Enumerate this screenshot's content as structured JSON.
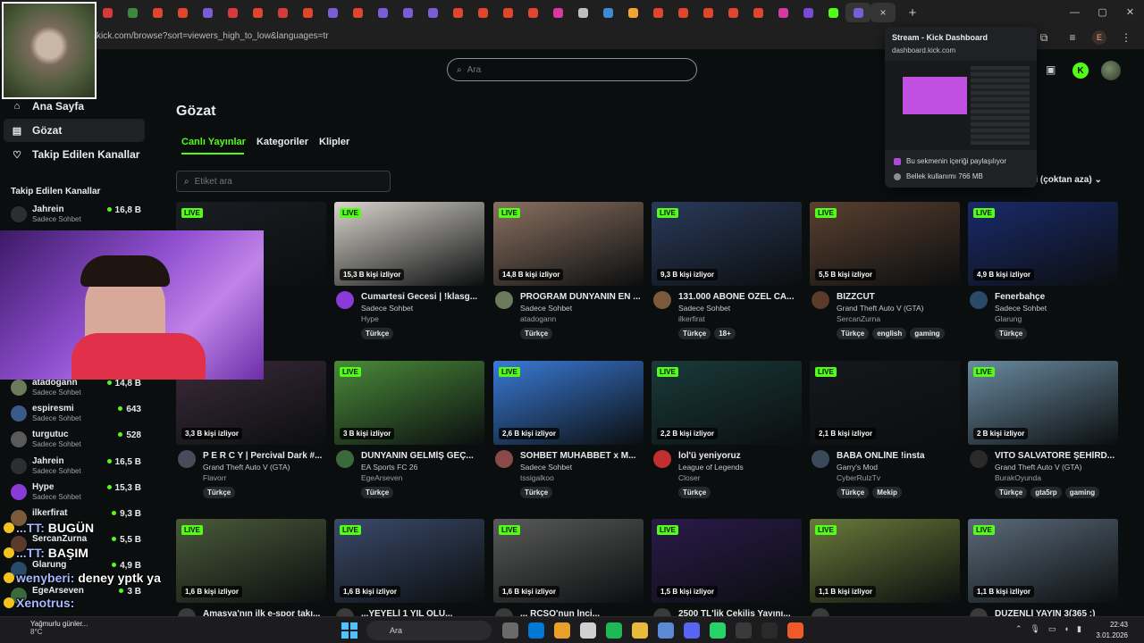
{
  "browser": {
    "url": "kick.com/browse?sort=viewers_high_to_low&languages=tr",
    "tab_colors": [
      "#d63a3a",
      "#3b8a3b",
      "#e0452e",
      "#e0452e",
      "#7a5cd6",
      "#d63a3a",
      "#e0452e",
      "#d63a3a",
      "#e0452e",
      "#7a5cd6",
      "#e0452e",
      "#7a5cd6",
      "#7a5cd6",
      "#7a5cd6",
      "#e0452e",
      "#e0452e",
      "#e0452e",
      "#e0452e",
      "#d63aa0",
      "#bfbfbf",
      "#3b8ad6",
      "#f2a531",
      "#e0452e",
      "#e0452e",
      "#e0452e",
      "#e0452e",
      "#e0452e",
      "#d63aa0",
      "#7a4ad6",
      "#53fc18",
      "#7a5cd6"
    ],
    "tab_close": "×",
    "new_tab": "+",
    "profile_letter": "E"
  },
  "tab_popup": {
    "title": "Stream - Kick Dashboard",
    "url": "dashboard.kick.com",
    "sharing_text": "Bu sekmenin içeriği paylaşılıyor",
    "memory_text": "Bellek kullanımı 766 MB"
  },
  "header": {
    "search_placeholder": "Ara",
    "logo_letter": "K"
  },
  "sidebar": {
    "nav": [
      {
        "label": "Ana Sayfa",
        "icon": "home-icon",
        "glyph": "⌂"
      },
      {
        "label": "Gözat",
        "icon": "browse-icon",
        "glyph": "▤"
      },
      {
        "label": "Takip Edilen Kanallar",
        "icon": "heart-icon",
        "glyph": "♡"
      }
    ],
    "following_title": "Takip Edilen Kanallar",
    "channels": [
      {
        "name": "Jahrein",
        "category": "Sadece Sohbet",
        "viewers": "16,8 B",
        "color": "#2c2f31"
      },
      {
        "name": "atadogann",
        "category": "Sadece Sohbet",
        "viewers": "14,8 B",
        "color": "#6b7a5a"
      },
      {
        "name": "espiresmi",
        "category": "Sadece Sohbet",
        "viewers": "643",
        "color": "#3a5a8a"
      },
      {
        "name": "turgutuc",
        "category": "Sadece Sohbet",
        "viewers": "528",
        "color": "#5a5a5a"
      },
      {
        "name": "Jahrein",
        "category": "Sadece Sohbet",
        "viewers": "16,5 B",
        "color": "#2c2f31"
      },
      {
        "name": "Hype",
        "category": "Sadece Sohbet",
        "viewers": "15,3 B",
        "color": "#8a3ad6"
      },
      {
        "name": "ilkerfirat",
        "category": "",
        "viewers": "9,3 B",
        "color": "#7a5a3a"
      },
      {
        "name": "SercanZurna",
        "category": "",
        "viewers": "5,5 B",
        "color": "#5a3a2a"
      },
      {
        "name": "Glarung",
        "category": "",
        "viewers": "4,9 B",
        "color": "#2a4a6a"
      },
      {
        "name": "EgeArseven",
        "category": "",
        "viewers": "3 B",
        "color": "#3a6a3a"
      }
    ]
  },
  "main": {
    "title": "Gözat",
    "tabs": [
      "Canlı Yayınlar",
      "Kategoriler",
      "Klipler"
    ],
    "tag_search_placeholder": "Etiket ara",
    "sort_label": "ici (çoktan aza)",
    "live_label": "LIVE",
    "cards": [
      {
        "viewers": "",
        "title": "adara olma...",
        "category": "",
        "channel": "",
        "tags": [],
        "thumb": "#1a1d22",
        "avatar": "#2c2f31"
      },
      {
        "viewers": "15,3 B kişi izliyor",
        "title": "Cumartesi Gecesi | !klasg...",
        "category": "Sadece Sohbet",
        "channel": "Hype",
        "tags": [
          "Türkçe"
        ],
        "thumb": "#d9d4cc",
        "avatar": "#8a3ad6"
      },
      {
        "viewers": "14,8 B kişi izliyor",
        "title": "PROGRAM DÜNYANIN EN ...",
        "category": "Sadece Sohbet",
        "channel": "atadogann",
        "tags": [
          "Türkçe"
        ],
        "thumb": "#8a7060",
        "avatar": "#6b7a5a"
      },
      {
        "viewers": "9,3 B kişi izliyor",
        "title": "131.000 ABONE ÖZEL CA...",
        "category": "Sadece Sohbet",
        "channel": "ilkerfirat",
        "tags": [
          "Türkçe",
          "18+"
        ],
        "thumb": "#2a3a5a",
        "avatar": "#7a5a3a"
      },
      {
        "viewers": "5,5 B kişi izliyor",
        "title": "BIZZCUT",
        "category": "Grand Theft Auto V (GTA)",
        "channel": "SercanZurna",
        "tags": [
          "Türkçe",
          "english",
          "gaming"
        ],
        "thumb": "#5a4030",
        "avatar": "#5a3a2a"
      },
      {
        "viewers": "4,9 B kişi izliyor",
        "title": "Fenerbahçe",
        "category": "Sadece Sohbet",
        "channel": "Glarung",
        "tags": [
          "Türkçe"
        ],
        "thumb": "#1a2a6a",
        "avatar": "#2a4a6a"
      },
      {
        "viewers": "3,3 B kişi izliyor",
        "title": "P E R C Y | Percival Dark #...",
        "category": "Grand Theft Auto V (GTA)",
        "channel": "Flavorr",
        "tags": [
          "Türkçe"
        ],
        "thumb": "#3a2a3a",
        "avatar": "#4a4a5a"
      },
      {
        "viewers": "3 B kişi izliyor",
        "title": "DÜNYANIN GELMİŞ GEÇ...",
        "category": "EA Sports FC 26",
        "channel": "EgeArseven",
        "tags": [
          "Türkçe"
        ],
        "thumb": "#4a8a3a",
        "avatar": "#3a6a3a"
      },
      {
        "viewers": "2,6 B kişi izliyor",
        "title": "SOHBET MUHABBET x M...",
        "category": "Sadece Sohbet",
        "channel": "tssigalkoo",
        "tags": [
          "Türkçe"
        ],
        "thumb": "#3a7ad6",
        "avatar": "#8a4a4a"
      },
      {
        "viewers": "2,2 B kişi izliyor",
        "title": "lol'ü yeniyoruz",
        "category": "League of Legends",
        "channel": "Closer",
        "tags": [
          "Türkçe"
        ],
        "thumb": "#1a3a3a",
        "avatar": "#c03030"
      },
      {
        "viewers": "2,1 B kişi izliyor",
        "title": "BABA ONLİNE !insta",
        "category": "Garry's Mod",
        "channel": "CyberRulzTv",
        "tags": [
          "Türkçe",
          "Mekip"
        ],
        "thumb": "#15181c",
        "avatar": "#3a4a5a"
      },
      {
        "viewers": "2 B kişi izliyor",
        "title": "VITO SALVATORE ŞEHİRD...",
        "category": "Grand Theft Auto V (GTA)",
        "channel": "BurakOyunda",
        "tags": [
          "Türkçe",
          "gta5rp",
          "gaming"
        ],
        "thumb": "#6a8aa0",
        "avatar": "#2a2a2a"
      },
      {
        "viewers": "1,6 B kişi izliyor",
        "title": "Amasya'nın ilk e-spor takı...",
        "category": "",
        "channel": "",
        "tags": [],
        "thumb": "#4a5a3a",
        "avatar": "#3a3a3a"
      },
      {
        "viewers": "1,6 B kişi izliyor",
        "title": "...YEYELİ 1 YIL OLU...",
        "category": "",
        "channel": "",
        "tags": [],
        "thumb": "#3a4a6a",
        "avatar": "#3a3a3a"
      },
      {
        "viewers": "1,6 B kişi izliyor",
        "title": "... RCSO'nun İnci...",
        "category": "",
        "channel": "",
        "tags": [],
        "thumb": "#5a5a5a",
        "avatar": "#3a3a3a"
      },
      {
        "viewers": "1,5 B kişi izliyor",
        "title": "2500 TL'lik Çekiliş Yayını...",
        "category": "",
        "channel": "",
        "tags": [],
        "thumb": "#2a1a4a",
        "avatar": "#3a3a3a"
      },
      {
        "viewers": "1,1 B kişi izliyor",
        "title": "",
        "category": "",
        "channel": "",
        "tags": [],
        "thumb": "#6a7a3a",
        "avatar": "#3a3a3a"
      },
      {
        "viewers": "1,1 B kişi izliyor",
        "title": "DÜZENLİ YAYIN 3(365 :)",
        "category": "",
        "channel": "",
        "tags": [],
        "thumb": "#5a6a7a",
        "avatar": "#3a3a3a"
      }
    ]
  },
  "chat_overlay": [
    {
      "user": "...TT:",
      "msg": "BUGÜN"
    },
    {
      "user": "...TT:",
      "msg": "BAŞIM"
    },
    {
      "user": "wenyberi:",
      "msg": "deney yptk ya"
    },
    {
      "user": "Xenotrus:",
      "msg": ""
    }
  ],
  "taskbar": {
    "weather_text": "Yağmurlu günler...",
    "temperature": "8°C",
    "search_label": "Ara",
    "time": "22:43",
    "date": "3.01.2026",
    "app_colors": [
      "#6a6a6a",
      "#0078d4",
      "#e8a02a",
      "#d0d0d0",
      "#1db954",
      "#e8b93a",
      "#5a8ad6",
      "#5865f2",
      "#25d366",
      "#3a3a3a",
      "#2a2a2a",
      "#f05a28"
    ]
  }
}
